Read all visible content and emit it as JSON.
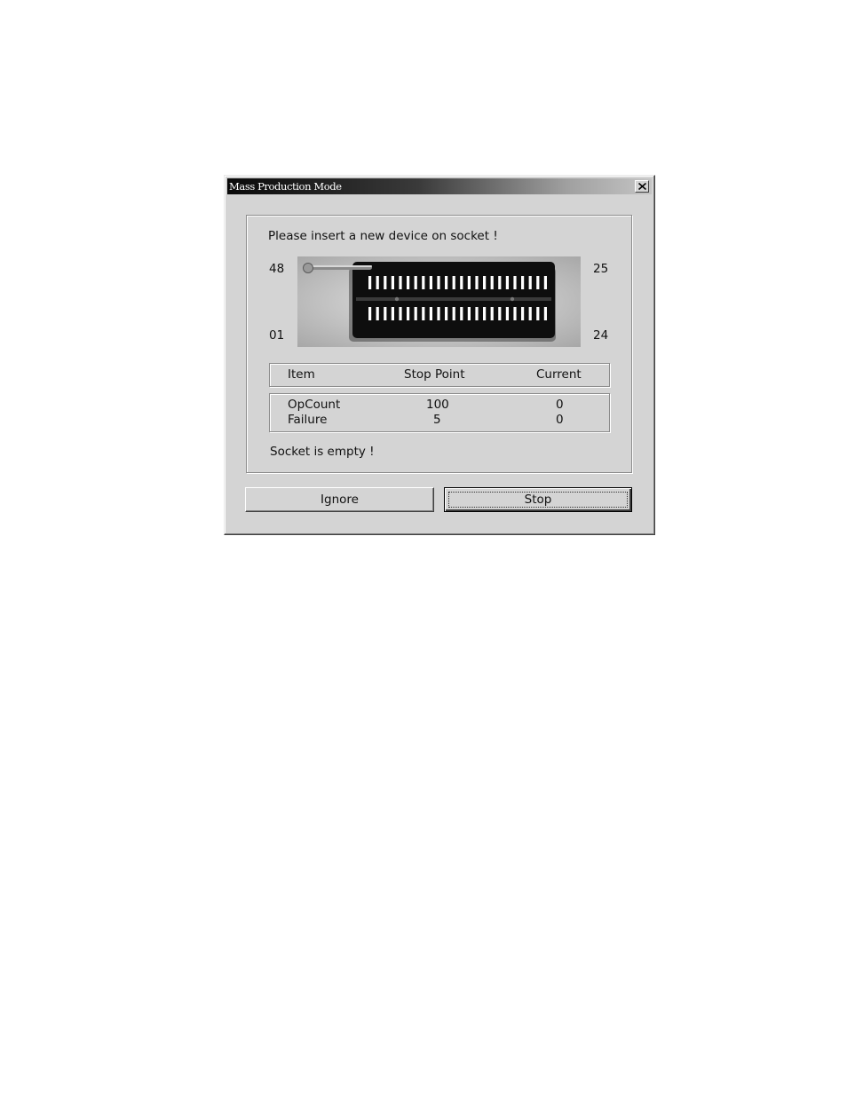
{
  "window": {
    "title": "Mass Production Mode",
    "close_icon": "close-icon"
  },
  "prompt": "Please insert a new device on socket !",
  "socket": {
    "icon": "zif-socket-image",
    "pin_top_left": "48",
    "pin_top_right": "25",
    "pin_bottom_left": "01",
    "pin_bottom_right": "24"
  },
  "table": {
    "headers": [
      "Item",
      "Stop Point",
      "Current"
    ],
    "rows": [
      [
        "OpCount",
        "100",
        "0"
      ],
      [
        "Failure",
        "5",
        "0"
      ]
    ]
  },
  "status": "Socket is empty !",
  "buttons": {
    "ignore": "Ignore",
    "stop": "Stop"
  }
}
